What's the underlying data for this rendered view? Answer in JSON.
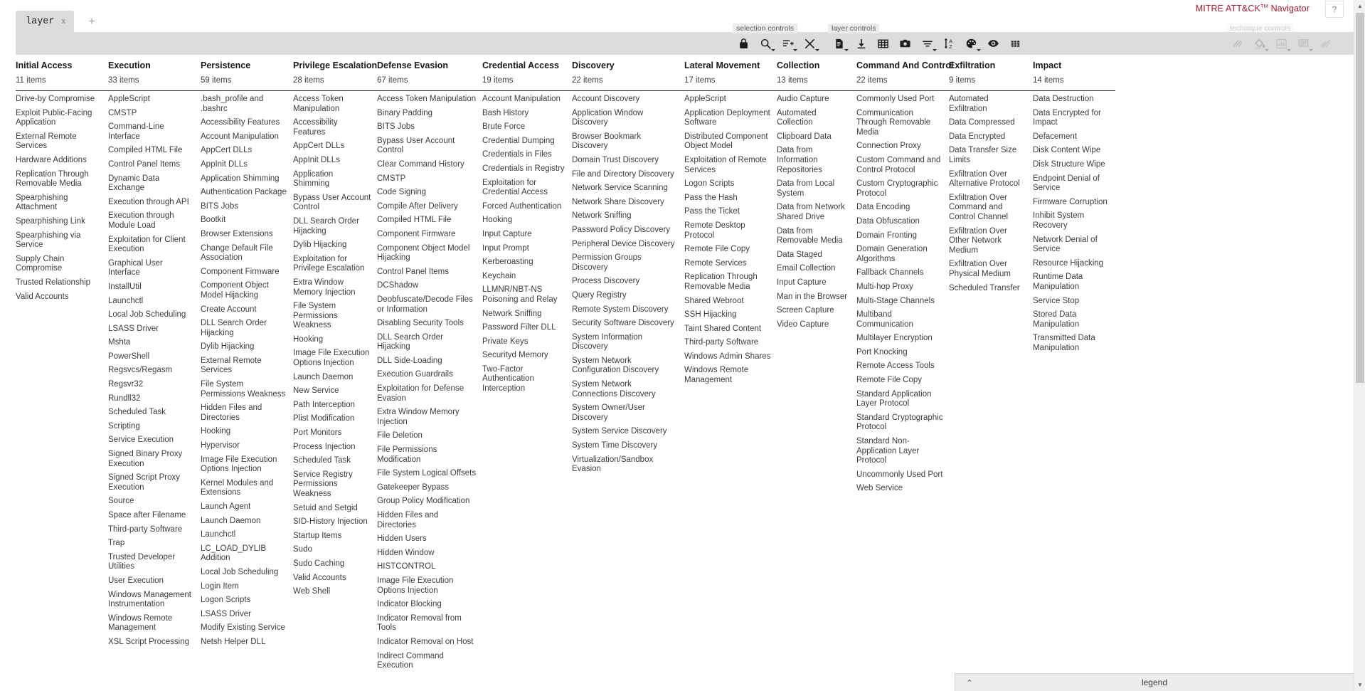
{
  "header": {
    "brand": "MITRE ATT&CK",
    "brand_sup": "TM",
    "brand_suffix": " Navigator",
    "help_label": "?"
  },
  "tabs": {
    "items": [
      {
        "label": "layer",
        "close": "x"
      }
    ],
    "add_label": "+"
  },
  "toolbar": {
    "groups": [
      {
        "name": "selection controls",
        "label": "selection controls"
      },
      {
        "name": "layer controls",
        "label": "layer controls"
      },
      {
        "name": "technique controls",
        "label": "technique controls"
      }
    ]
  },
  "legend": {
    "title": "legend",
    "toggle": "⌃"
  },
  "scrollbar": {
    "up": "▲",
    "down": "▼"
  },
  "matrix": {
    "tactics": [
      {
        "name": "Initial Access",
        "count": "11 items",
        "techniques": [
          "Drive-by Compromise",
          "Exploit Public-Facing Application",
          "External Remote Services",
          "Hardware Additions",
          "Replication Through Removable Media",
          "Spearphishing Attachment",
          "Spearphishing Link",
          "Spearphishing via Service",
          "Supply Chain Compromise",
          "Trusted Relationship",
          "Valid Accounts"
        ]
      },
      {
        "name": "Execution",
        "count": "33 items",
        "techniques": [
          "AppleScript",
          "CMSTP",
          "Command-Line Interface",
          "Compiled HTML File",
          "Control Panel Items",
          "Dynamic Data Exchange",
          "Execution through API",
          "Execution through Module Load",
          "Exploitation for Client Execution",
          "Graphical User Interface",
          "InstallUtil",
          "Launchctl",
          "Local Job Scheduling",
          "LSASS Driver",
          "Mshta",
          "PowerShell",
          "Regsvcs/Regasm",
          "Regsvr32",
          "Rundll32",
          "Scheduled Task",
          "Scripting",
          "Service Execution",
          "Signed Binary Proxy Execution",
          "Signed Script Proxy Execution",
          "Source",
          "Space after Filename",
          "Third-party Software",
          "Trap",
          "Trusted Developer Utilities",
          "User Execution",
          "Windows Management Instrumentation",
          "Windows Remote Management",
          "XSL Script Processing"
        ]
      },
      {
        "name": "Persistence",
        "count": "59 items",
        "techniques": [
          ".bash_profile and .bashrc",
          "Accessibility Features",
          "Account Manipulation",
          "AppCert DLLs",
          "AppInit DLLs",
          "Application Shimming",
          "Authentication Package",
          "BITS Jobs",
          "Bootkit",
          "Browser Extensions",
          "Change Default File Association",
          "Component Firmware",
          "Component Object Model Hijacking",
          "Create Account",
          "DLL Search Order Hijacking",
          "Dylib Hijacking",
          "External Remote Services",
          "File System Permissions Weakness",
          "Hidden Files and Directories",
          "Hooking",
          "Hypervisor",
          "Image File Execution Options Injection",
          "Kernel Modules and Extensions",
          "Launch Agent",
          "Launch Daemon",
          "Launchctl",
          "LC_LOAD_DYLIB Addition",
          "Local Job Scheduling",
          "Login Item",
          "Logon Scripts",
          "LSASS Driver",
          "Modify Existing Service",
          "Netsh Helper DLL"
        ]
      },
      {
        "name": "Privilege Escalation",
        "count": "28 items",
        "techniques": [
          "Access Token Manipulation",
          "Accessibility Features",
          "AppCert DLLs",
          "AppInit DLLs",
          "Application Shimming",
          "Bypass User Account Control",
          "DLL Search Order Hijacking",
          "Dylib Hijacking",
          "Exploitation for Privilege Escalation",
          "Extra Window Memory Injection",
          "File System Permissions Weakness",
          "Hooking",
          "Image File Execution Options Injection",
          "Launch Daemon",
          "New Service",
          "Path Interception",
          "Plist Modification",
          "Port Monitors",
          "Process Injection",
          "Scheduled Task",
          "Service Registry Permissions Weakness",
          "Setuid and Setgid",
          "SID-History Injection",
          "Startup Items",
          "Sudo",
          "Sudo Caching",
          "Valid Accounts",
          "Web Shell"
        ]
      },
      {
        "name": "Defense Evasion",
        "count": "67 items",
        "techniques": [
          "Access Token Manipulation",
          "Binary Padding",
          "BITS Jobs",
          "Bypass User Account Control",
          "Clear Command History",
          "CMSTP",
          "Code Signing",
          "Compile After Delivery",
          "Compiled HTML File",
          "Component Firmware",
          "Component Object Model Hijacking",
          "Control Panel Items",
          "DCShadow",
          "Deobfuscate/Decode Files or Information",
          "Disabling Security Tools",
          "DLL Search Order Hijacking",
          "DLL Side-Loading",
          "Execution Guardrails",
          "Exploitation for Defense Evasion",
          "Extra Window Memory Injection",
          "File Deletion",
          "File Permissions Modification",
          "File System Logical Offsets",
          "Gatekeeper Bypass",
          "Group Policy Modification",
          "Hidden Files and Directories",
          "Hidden Users",
          "Hidden Window",
          "HISTCONTROL",
          "Image File Execution Options Injection",
          "Indicator Blocking",
          "Indicator Removal from Tools",
          "Indicator Removal on Host",
          "Indirect Command Execution"
        ]
      },
      {
        "name": "Credential Access",
        "count": "19 items",
        "techniques": [
          "Account Manipulation",
          "Bash History",
          "Brute Force",
          "Credential Dumping",
          "Credentials in Files",
          "Credentials in Registry",
          "Exploitation for Credential Access",
          "Forced Authentication",
          "Hooking",
          "Input Capture",
          "Input Prompt",
          "Kerberoasting",
          "Keychain",
          "LLMNR/NBT-NS Poisoning and Relay",
          "Network Sniffing",
          "Password Filter DLL",
          "Private Keys",
          "Securityd Memory",
          "Two-Factor Authentication Interception"
        ]
      },
      {
        "name": "Discovery",
        "count": "22 items",
        "techniques": [
          "Account Discovery",
          "Application Window Discovery",
          "Browser Bookmark Discovery",
          "Domain Trust Discovery",
          "File and Directory Discovery",
          "Network Service Scanning",
          "Network Share Discovery",
          "Network Sniffing",
          "Password Policy Discovery",
          "Peripheral Device Discovery",
          "Permission Groups Discovery",
          "Process Discovery",
          "Query Registry",
          "Remote System Discovery",
          "Security Software Discovery",
          "System Information Discovery",
          "System Network Configuration Discovery",
          "System Network Connections Discovery",
          "System Owner/User Discovery",
          "System Service Discovery",
          "System Time Discovery",
          "Virtualization/Sandbox Evasion"
        ]
      },
      {
        "name": "Lateral Movement",
        "count": "17 items",
        "techniques": [
          "AppleScript",
          "Application Deployment Software",
          "Distributed Component Object Model",
          "Exploitation of Remote Services",
          "Logon Scripts",
          "Pass the Hash",
          "Pass the Ticket",
          "Remote Desktop Protocol",
          "Remote File Copy",
          "Remote Services",
          "Replication Through Removable Media",
          "Shared Webroot",
          "SSH Hijacking",
          "Taint Shared Content",
          "Third-party Software",
          "Windows Admin Shares",
          "Windows Remote Management"
        ]
      },
      {
        "name": "Collection",
        "count": "13 items",
        "techniques": [
          "Audio Capture",
          "Automated Collection",
          "Clipboard Data",
          "Data from Information Repositories",
          "Data from Local System",
          "Data from Network Shared Drive",
          "Data from Removable Media",
          "Data Staged",
          "Email Collection",
          "Input Capture",
          "Man in the Browser",
          "Screen Capture",
          "Video Capture"
        ]
      },
      {
        "name": "Command And Control",
        "count": "22 items",
        "techniques": [
          "Commonly Used Port",
          "Communication Through Removable Media",
          "Connection Proxy",
          "Custom Command and Control Protocol",
          "Custom Cryptographic Protocol",
          "Data Encoding",
          "Data Obfuscation",
          "Domain Fronting",
          "Domain Generation Algorithms",
          "Fallback Channels",
          "Multi-hop Proxy",
          "Multi-Stage Channels",
          "Multiband Communication",
          "Multilayer Encryption",
          "Port Knocking",
          "Remote Access Tools",
          "Remote File Copy",
          "Standard Application Layer Protocol",
          "Standard Cryptographic Protocol",
          "Standard Non-Application Layer Protocol",
          "Uncommonly Used Port",
          "Web Service"
        ]
      },
      {
        "name": "Exfiltration",
        "count": "9 items",
        "techniques": [
          "Automated Exfiltration",
          "Data Compressed",
          "Data Encrypted",
          "Data Transfer Size Limits",
          "Exfiltration Over Alternative Protocol",
          "Exfiltration Over Command and Control Channel",
          "Exfiltration Over Other Network Medium",
          "Exfiltration Over Physical Medium",
          "Scheduled Transfer"
        ]
      },
      {
        "name": "Impact",
        "count": "14 items",
        "techniques": [
          "Data Destruction",
          "Data Encrypted for Impact",
          "Defacement",
          "Disk Content Wipe",
          "Disk Structure Wipe",
          "Endpoint Denial of Service",
          "Firmware Corruption",
          "Inhibit System Recovery",
          "Network Denial of Service",
          "Resource Hijacking",
          "Runtime Data Manipulation",
          "Service Stop",
          "Stored Data Manipulation",
          "Transmitted Data Manipulation"
        ]
      }
    ]
  }
}
